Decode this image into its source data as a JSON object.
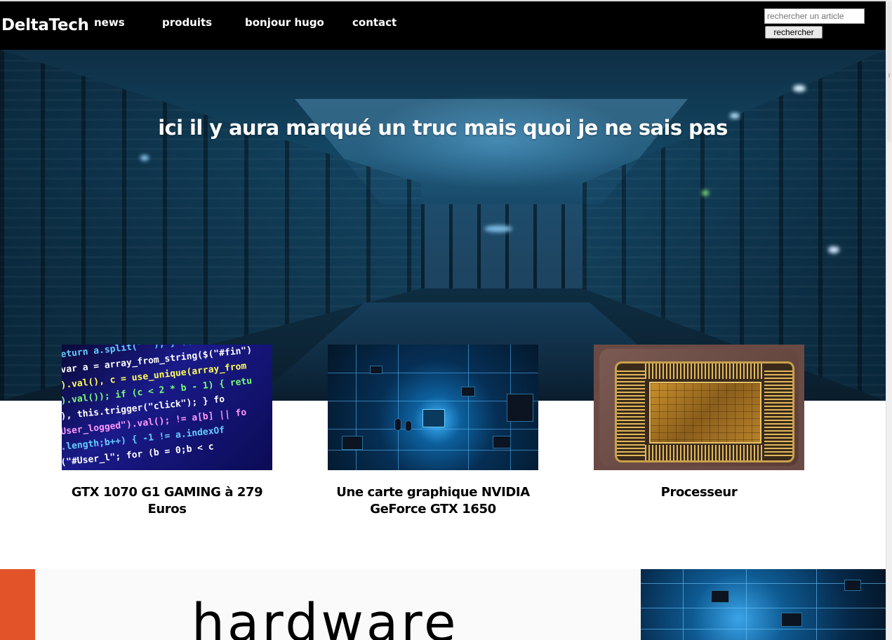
{
  "nav": {
    "brand": "DeltaTech",
    "links": [
      "news",
      "produits",
      "bonjour hugo",
      "contact"
    ],
    "search_placeholder": "rechercher un article",
    "search_button": "rechercher"
  },
  "hero": {
    "title": "ici il y aura marqué un truc mais quoi je ne sais pas"
  },
  "cards": [
    {
      "title": "GTX 1070 G1 GAMING à 279 Euros",
      "image": "code-screen-image"
    },
    {
      "title": "Une carte graphique NVIDIA GeForce GTX 1650",
      "image": "circuit-board-image"
    },
    {
      "title": "Processeur",
      "image": "processor-chip-image"
    }
  ],
  "section": {
    "title": "hardware",
    "accent_color": "#e2532a"
  },
  "colors": {
    "navbar": "#000000",
    "text_on_dark": "#ffffff",
    "hero_tint": "#134663"
  }
}
